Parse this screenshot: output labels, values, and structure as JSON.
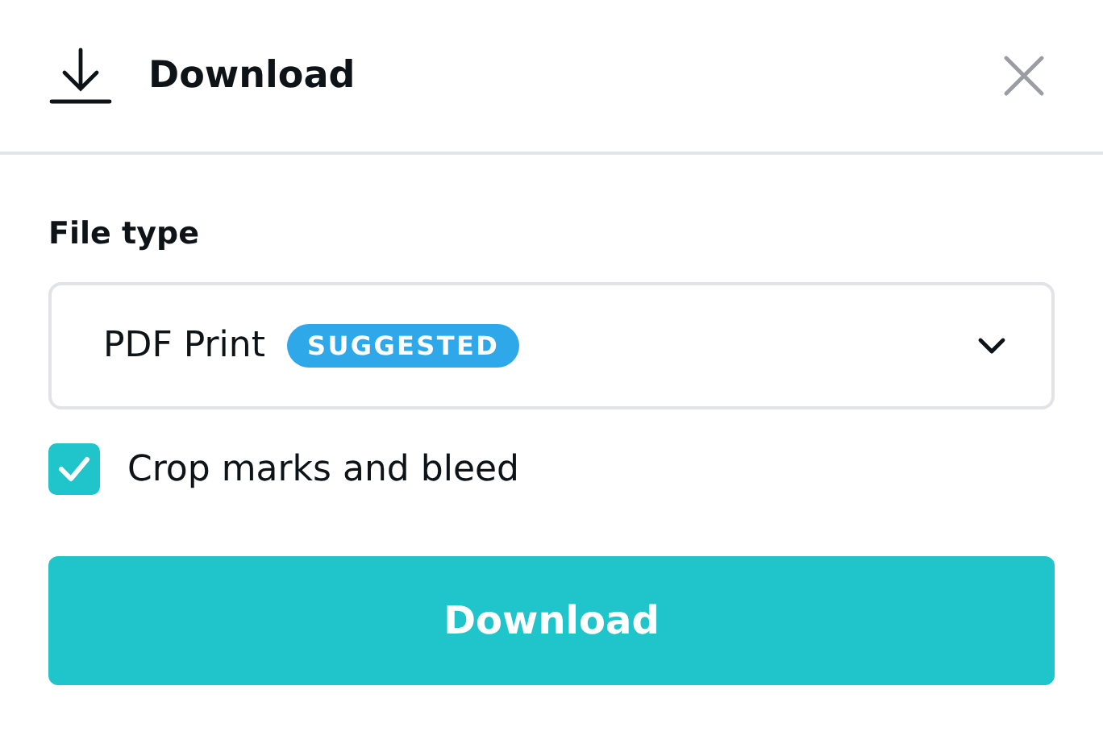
{
  "dialog": {
    "title": "Download"
  },
  "file_type": {
    "label": "File type",
    "value": "PDF Print",
    "badge": "SUGGESTED"
  },
  "crop_marks": {
    "label": "Crop marks and bleed",
    "checked": true
  },
  "button": {
    "label": "Download"
  }
}
